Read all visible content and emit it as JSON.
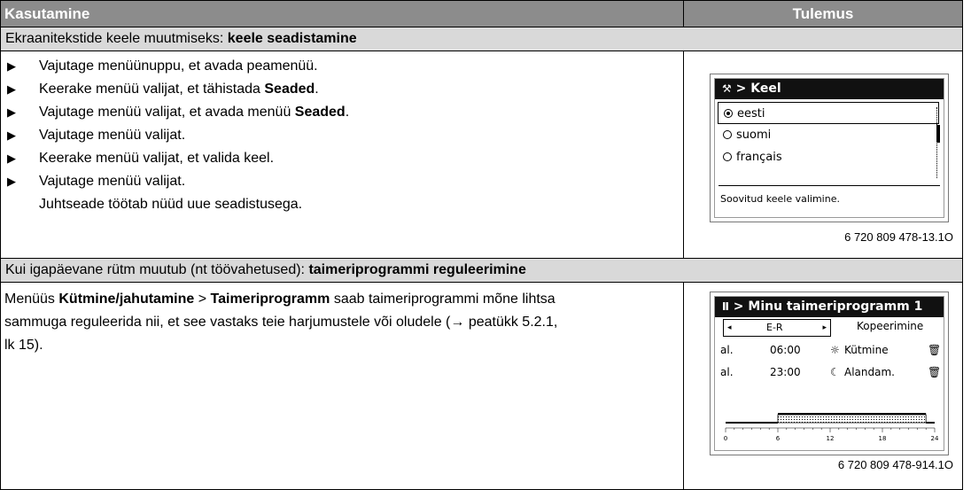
{
  "header": {
    "col1": "Kasutamine",
    "col2": "Tulemus"
  },
  "section1": {
    "text": "Ekraanitekstide keele muutmiseks: ",
    "bold": "keele seadistamine"
  },
  "steps1": [
    {
      "text": "Vajutage menüünuppu, et avada peamenüü.",
      "bold": "",
      "end": ""
    },
    {
      "text": "Keerake menüü valijat, et tähistada ",
      "bold": "Seaded",
      "end": "."
    },
    {
      "text": "Vajutage menüü valijat, et avada menüü ",
      "bold": "Seaded",
      "end": "."
    },
    {
      "text": "Vajutage menüü valijat.",
      "bold": "",
      "end": ""
    },
    {
      "text": "Keerake menüü valijat, et valida keel.",
      "bold": "",
      "end": ""
    },
    {
      "text": "Vajutage menüü valijat.",
      "bold": "",
      "end": ""
    }
  ],
  "steps1_continuation": "Juhtseade töötab nüüd uue seadistusega.",
  "screen1": {
    "title": "> Keel",
    "options": [
      "eesti",
      "suomi",
      "français"
    ],
    "hint": "Soovitud keele valimine.",
    "figure": "6 720 809 478-13.1O"
  },
  "section2": {
    "text": "Kui igapäevane rütm muutub (nt töövahetused): ",
    "bold": "taimeriprogrammi reguleerimine"
  },
  "para2": {
    "pre": "Menüüs ",
    "b1": "Kütmine/jahutamine",
    "mid": "  > ",
    "b2": "Taimeriprogramm",
    "post1": " saab taimeriprogrammi mõne lihtsa",
    "line2": "sammuga reguleerida nii, et see vastaks teie harjumustele või oludele (→ peatükk 5.2.1,",
    "line3": "lk 15)."
  },
  "screen2": {
    "title": "> Minu taimeriprogramm 1",
    "day": "E-R",
    "copy": "Kopeerimine",
    "rows": [
      {
        "from": "al.",
        "time": "06:00",
        "mode_icon": "sun-icon",
        "mode": "Kütmine"
      },
      {
        "from": "al.",
        "time": "23:00",
        "mode_icon": "moon-icon",
        "mode": "Alandam."
      }
    ],
    "ticks": [
      "0",
      "6",
      "12",
      "18",
      "24"
    ],
    "heating_period_hours": [
      6,
      23
    ],
    "figure": "6 720 809 478-914.1O"
  }
}
